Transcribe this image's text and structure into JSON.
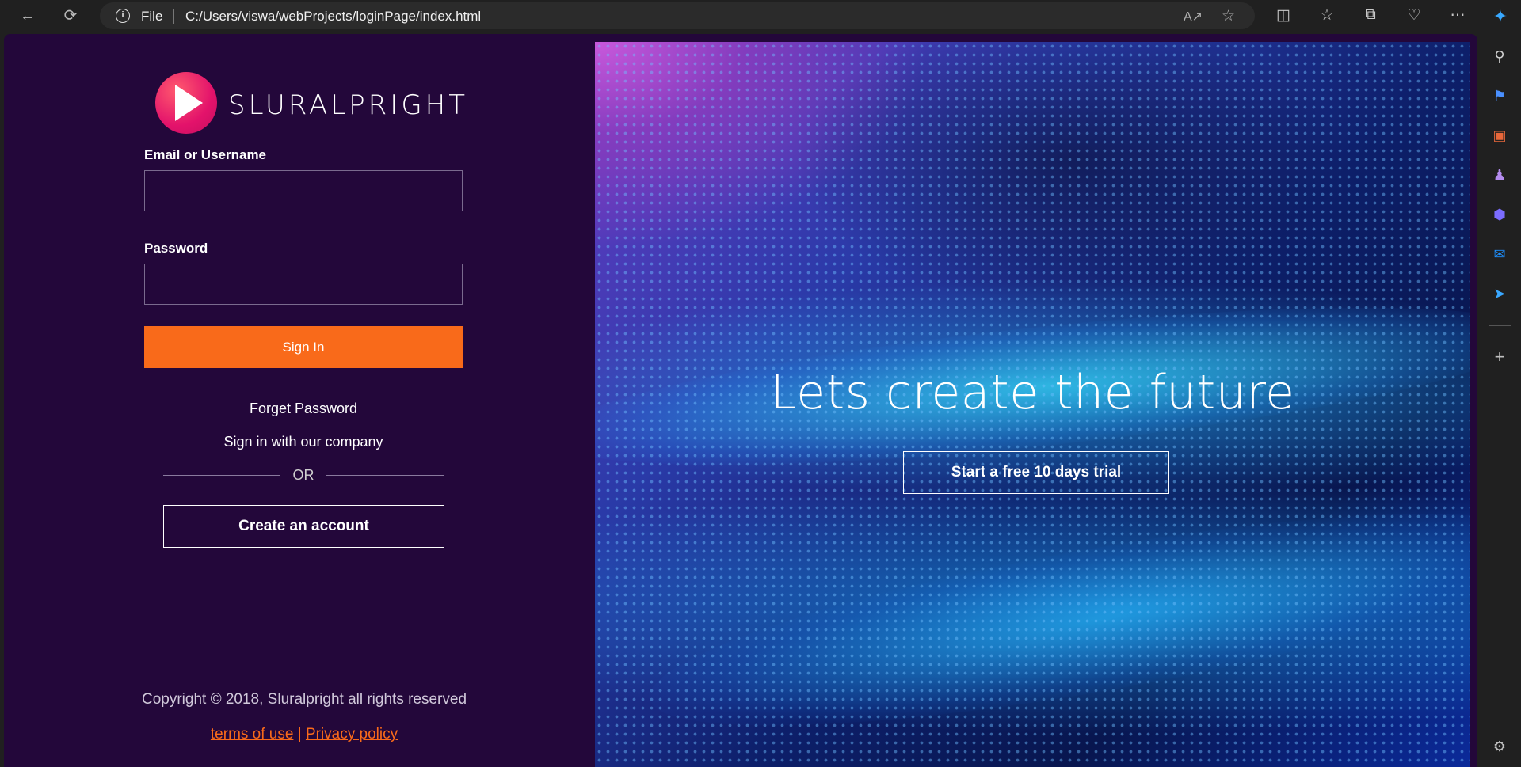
{
  "browser": {
    "file_label": "File",
    "url": "C:/Users/viswa/webProjects/loginPage/index.html"
  },
  "login": {
    "brand": "SLURALPRIGHT",
    "email_label": "Email or Username",
    "password_label": "Password",
    "signin_label": "Sign In",
    "forget_label": "Forget Password",
    "company_label": "Sign in with our company",
    "or_label": "OR",
    "create_label": "Create an account",
    "copyright": "Copyright © 2018, Sluralpright all rights reserved",
    "terms_label": "terms of use",
    "separator": "|",
    "privacy_label": "Privacy policy"
  },
  "hero": {
    "title": "Lets create the future",
    "trial_label": "Start a free 10 days trial"
  },
  "colors": {
    "page_bg": "#23073a",
    "accent": "#f96a1a",
    "logo": "#e3126b"
  },
  "icons": [
    "back-icon",
    "refresh-icon",
    "info-icon",
    "read-aloud-icon",
    "favorite-star-icon",
    "split-screen-icon",
    "favorites-icon",
    "collections-icon",
    "health-icon",
    "more-icon",
    "copilot-icon",
    "search-icon",
    "tag-icon",
    "briefcase-icon",
    "games-icon",
    "office-icon",
    "outlook-icon",
    "send-icon",
    "add-icon",
    "settings-icon"
  ]
}
